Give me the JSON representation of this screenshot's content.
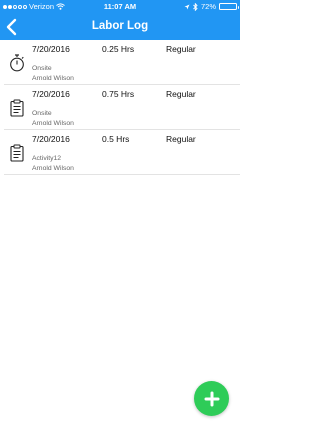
{
  "status_bar": {
    "carrier": "Verizon",
    "time": "11:07 AM",
    "battery": "72%",
    "battery_level": 0.72
  },
  "nav": {
    "title": "Labor Log",
    "back_icon": "chevron-left-icon"
  },
  "entries": [
    {
      "date": "7/20/2016",
      "hours": "0.25 Hrs",
      "type": "Regular",
      "activity": "Onsite",
      "person": "Arnold Wilson",
      "icon": "stopwatch-icon"
    },
    {
      "date": "7/20/2016",
      "hours": "0.75 Hrs",
      "type": "Regular",
      "activity": "Onsite",
      "person": "Arnold Wilson",
      "icon": "clipboard-icon"
    },
    {
      "date": "7/20/2016",
      "hours": "0.5 Hrs",
      "type": "Regular",
      "activity": "Activity12",
      "person": "Arnold Wilson",
      "icon": "clipboard-icon"
    }
  ],
  "fab": {
    "icon": "plus-icon"
  },
  "colors": {
    "header": "#2196f3",
    "fab": "#2ecc58",
    "divider": "#e3e3e3"
  }
}
